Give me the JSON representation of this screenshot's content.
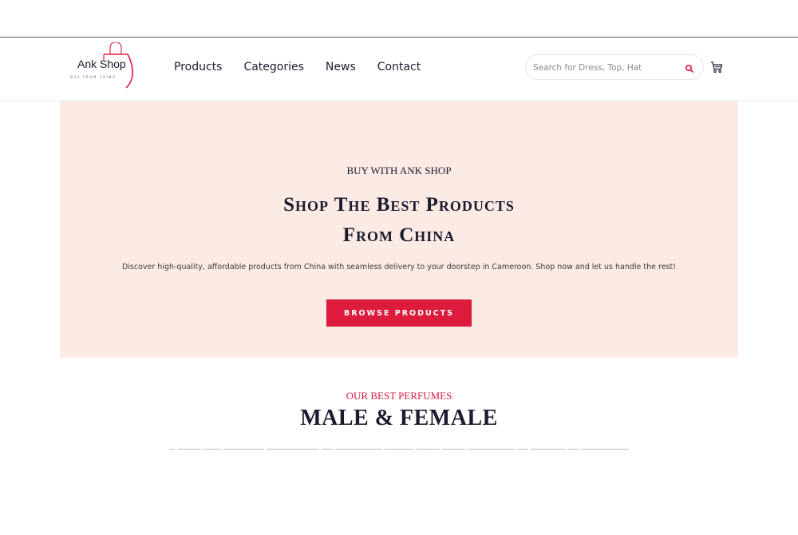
{
  "header": {
    "logo": {
      "name": "Ank Shop",
      "tagline": "BUY FROM CHINA"
    },
    "nav": [
      "Products",
      "Categories",
      "News",
      "Contact"
    ],
    "search": {
      "placeholder": "Search for Dress, Top, Hat",
      "icon": "search-icon"
    },
    "cart": {
      "icon": "cart-icon"
    }
  },
  "hero": {
    "kicker": "BUY WITH ANK SHOP",
    "title_line1": "Shop The Best Products",
    "title_line2": "From China",
    "description": "Discover high-quality, affordable products from China with seamless delivery to your doorstep in Cameroon. Shop now and let us handle the rest!",
    "button": "BROWSE PRODUCTS",
    "background": "#fcebe5",
    "button_color": "#dc1b3d"
  },
  "section": {
    "kicker": "OUR BEST PERFUMES",
    "title": "MALE & FEMALE"
  },
  "colors": {
    "accent": "#dc1b3d",
    "text": "#1b1b2f"
  }
}
